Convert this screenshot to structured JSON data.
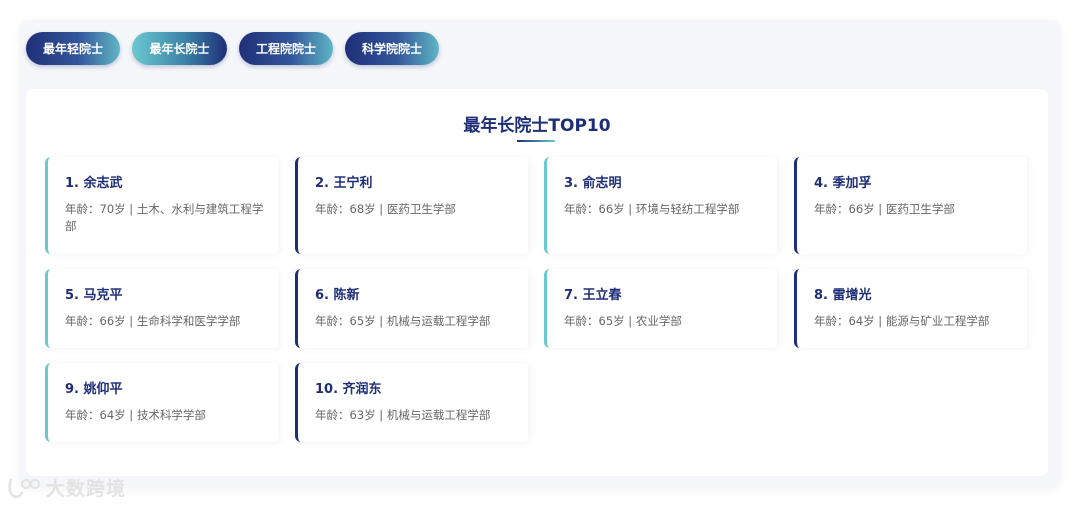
{
  "tabs": [
    {
      "label": "最年轻院士",
      "active": false
    },
    {
      "label": "最年长院士",
      "active": true
    },
    {
      "label": "工程院院士",
      "active": false
    },
    {
      "label": "科学院院士",
      "active": false
    }
  ],
  "panel": {
    "title": "最年长院士TOP10"
  },
  "cards": [
    {
      "name": "1. 余志武",
      "info": "年龄：70岁 | 土木、水利与建筑工程学部"
    },
    {
      "name": "2. 王宁利",
      "info": "年龄：68岁 | 医药卫生学部"
    },
    {
      "name": "3. 俞志明",
      "info": "年龄：66岁 | 环境与轻纺工程学部"
    },
    {
      "name": "4. 季加孚",
      "info": "年龄：66岁 | 医药卫生学部"
    },
    {
      "name": "5. 马克平",
      "info": "年龄：66岁 | 生命科学和医学学部"
    },
    {
      "name": "6. 陈新",
      "info": "年龄：65岁 | 机械与运载工程学部"
    },
    {
      "name": "7. 王立春",
      "info": "年龄：65岁 | 农业学部"
    },
    {
      "name": "8. 雷增光",
      "info": "年龄：64岁 | 能源与矿业工程学部"
    },
    {
      "name": "9. 姚仰平",
      "info": "年龄：64岁 | 技术科学学部"
    },
    {
      "name": "10. 齐润东",
      "info": "年龄：63岁 | 机械与运载工程学部"
    }
  ],
  "colors": {
    "navy": "#1e2f78",
    "teal": "#6ac8d0"
  },
  "watermark": {
    "text": "大数跨境",
    "icon": "brand-logo-icon"
  }
}
